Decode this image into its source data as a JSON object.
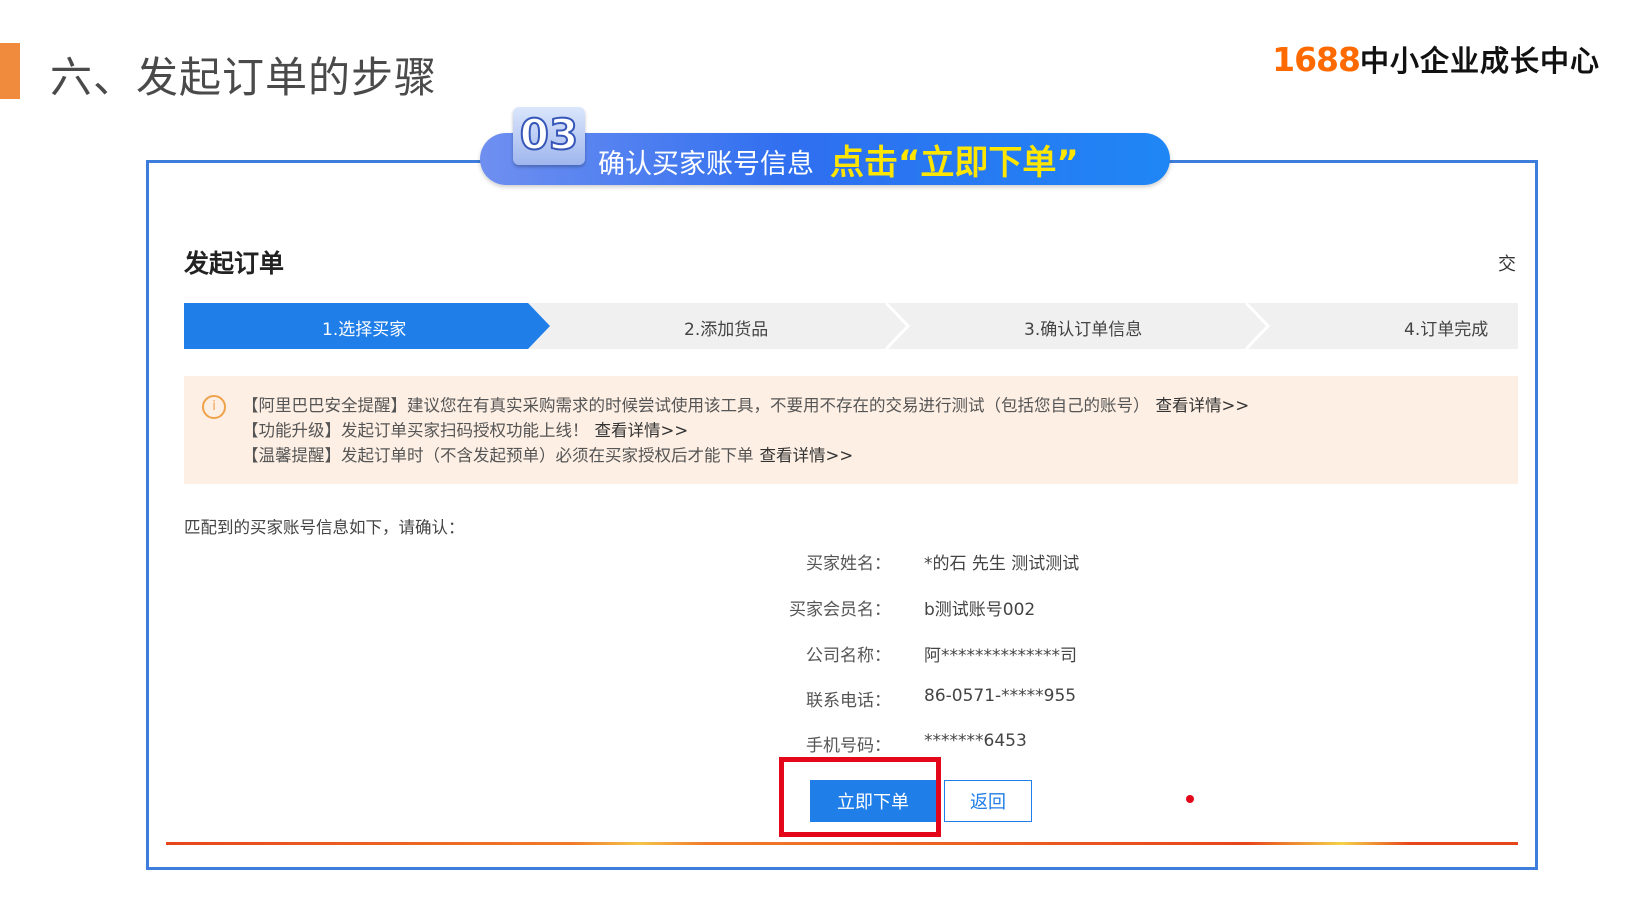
{
  "slide": {
    "title": "六、发起订单的步骤",
    "brand_number": "1688",
    "brand_text": "中小企业成长中心"
  },
  "banner": {
    "step_number": "03",
    "instruction": "确认买家账号信息",
    "cta": "点击“立即下单”"
  },
  "form": {
    "title": "发起订单",
    "corner_text": "交",
    "steps": [
      {
        "label": "1.选择买家",
        "active": true
      },
      {
        "label": "2.添加货品",
        "active": false
      },
      {
        "label": "3.确认订单信息",
        "active": false
      },
      {
        "label": "4.订单完成",
        "active": false
      }
    ],
    "alerts": [
      {
        "text": "【阿里巴巴安全提醒】建议您在有真实采购需求的时候尝试使用该工具，不要用不存在的交易进行测试（包括您自己的账号）",
        "link": "查看详情>>"
      },
      {
        "text": "【功能升级】发起订单买家扫码授权功能上线！",
        "link": "查看详情>>"
      },
      {
        "text": "【温馨提醒】发起订单时（不含发起预单）必须在买家授权后才能下单",
        "link": "查看详情>>"
      }
    ],
    "intro": "匹配到的买家账号信息如下，请确认：",
    "fields": [
      {
        "label": "买家姓名：",
        "value": "*的石 先生 测试测试"
      },
      {
        "label": "买家会员名：",
        "value": "b测试账号002"
      },
      {
        "label": "公司名称：",
        "value": "阿**************司"
      },
      {
        "label": "联系电话：",
        "value": "86-0571-*****955"
      },
      {
        "label": "手机号码：",
        "value": "*******6453"
      }
    ],
    "primary_button": "立即下单",
    "back_button": "返回"
  },
  "colors": {
    "accent_orange": "#f08a3c",
    "brand_orange": "#ff6a00",
    "primary_blue": "#1f7ee8",
    "frame_blue": "#3f7ddc",
    "highlight_red": "#e4071a",
    "cta_yellow": "#ffe600",
    "alert_bg": "#fdefe4"
  },
  "icons": {
    "alert": "info-circle-icon"
  }
}
